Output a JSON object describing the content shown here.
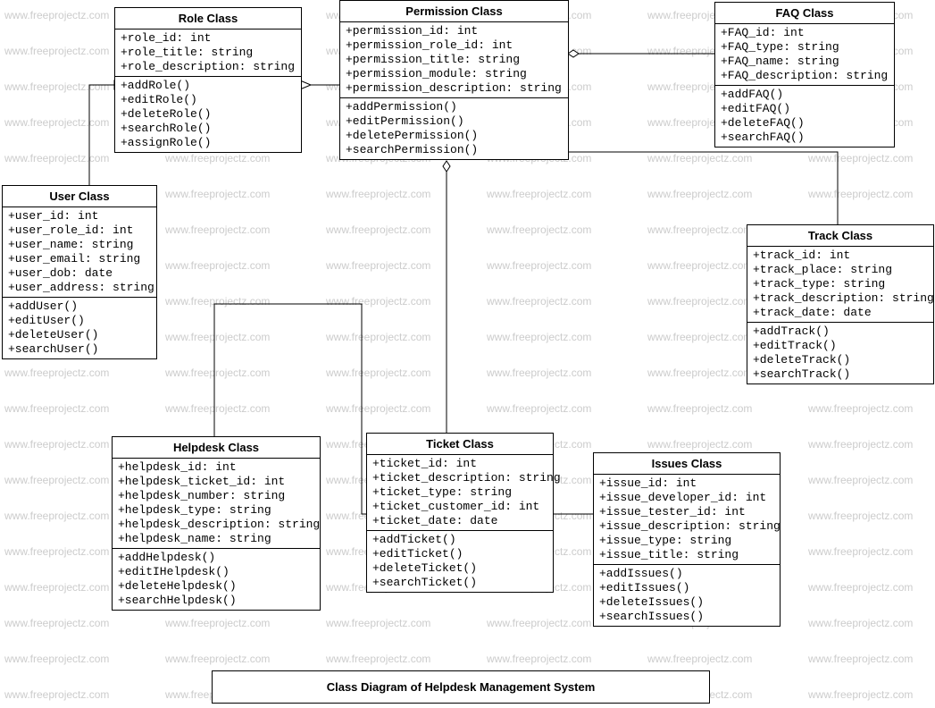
{
  "diagram_title": "Class Diagram of Helpdesk Management System",
  "watermark_text": "www.freeprojectz.com",
  "classes": {
    "role": {
      "name": "Role Class",
      "attributes": [
        "+role_id: int",
        "+role_title: string",
        "+role_description: string"
      ],
      "methods": [
        "+addRole()",
        "+editRole()",
        "+deleteRole()",
        "+searchRole()",
        "+assignRole()"
      ]
    },
    "permission": {
      "name": "Permission Class",
      "attributes": [
        "+permission_id: int",
        "+permission_role_id: int",
        "+permission_title: string",
        "+permission_module: string",
        "+permission_description: string"
      ],
      "methods": [
        "+addPermission()",
        "+editPermission()",
        "+deletePermission()",
        "+searchPermission()"
      ]
    },
    "faq": {
      "name": "FAQ Class",
      "attributes": [
        "+FAQ_id: int",
        "+FAQ_type: string",
        "+FAQ_name: string",
        "+FAQ_description: string"
      ],
      "methods": [
        "+addFAQ()",
        "+editFAQ()",
        "+deleteFAQ()",
        "+searchFAQ()"
      ]
    },
    "user": {
      "name": "User Class",
      "attributes": [
        "+user_id: int",
        "+user_role_id: int",
        "+user_name: string",
        "+user_email: string",
        "+user_dob: date",
        "+user_address: string"
      ],
      "methods": [
        "+addUser()",
        "+editUser()",
        "+deleteUser()",
        "+searchUser()"
      ]
    },
    "track": {
      "name": "Track Class",
      "attributes": [
        "+track_id: int",
        "+track_place: string",
        "+track_type: string",
        "+track_description: string",
        "+track_date: date"
      ],
      "methods": [
        "+addTrack()",
        "+editTrack()",
        "+deleteTrack()",
        "+searchTrack()"
      ]
    },
    "helpdesk": {
      "name": "Helpdesk Class",
      "attributes": [
        "+helpdesk_id: int",
        "+helpdesk_ticket_id: int",
        "+helpdesk_number: string",
        "+helpdesk_type: string",
        "+helpdesk_description: string",
        "+helpdesk_name: string"
      ],
      "methods": [
        "+addHelpdesk()",
        "+editIHelpdesk()",
        "+deleteHelpdesk()",
        "+searchHelpdesk()"
      ]
    },
    "ticket": {
      "name": "Ticket Class",
      "attributes": [
        "+ticket_id: int",
        "+ticket_description: string",
        "+ticket_type: string",
        "+ticket_customer_id: int",
        "+ticket_date: date"
      ],
      "methods": [
        "+addTicket()",
        "+editTicket()",
        "+deleteTicket()",
        "+searchTicket()"
      ]
    },
    "issues": {
      "name": "Issues Class",
      "attributes": [
        "+issue_id: int",
        "+issue_developer_id: int",
        "+issue_tester_id: int",
        "+issue_description: string",
        "+issue_type: string",
        "+issue_title: string"
      ],
      "methods": [
        "+addIssues()",
        "+editIssues()",
        "+deleteIssues()",
        "+searchIssues()"
      ]
    }
  }
}
